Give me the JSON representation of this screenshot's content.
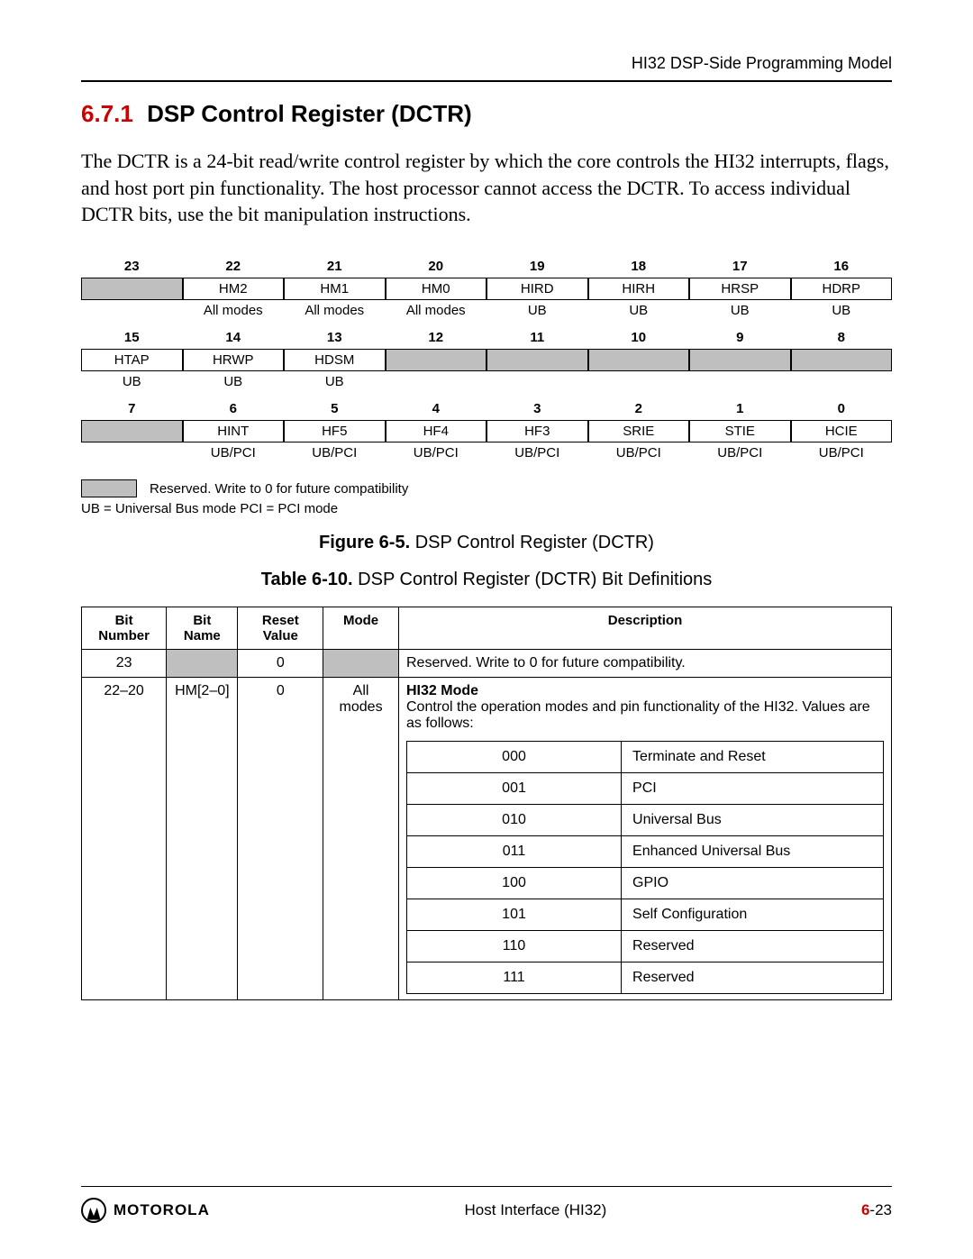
{
  "header": {
    "right_text": "HI32 DSP-Side Programming Model"
  },
  "section": {
    "number": "6.7.1",
    "title": "DSP Control Register (DCTR)",
    "paragraph": "The DCTR is a 24-bit read/write control register by which the core controls the HI32 interrupts, flags, and host port pin functionality. The host processor cannot access the DCTR. To access individual DCTR bits, use the bit manipulation instructions."
  },
  "register_figure": {
    "rows": [
      {
        "bits": [
          "23",
          "22",
          "21",
          "20",
          "19",
          "18",
          "17",
          "16"
        ],
        "names": [
          "",
          "HM2",
          "HM1",
          "HM0",
          "HIRD",
          "HIRH",
          "HRSP",
          "HDRP"
        ],
        "shaded": [
          true,
          false,
          false,
          false,
          false,
          false,
          false,
          false
        ],
        "modes": [
          "",
          "All modes",
          "All modes",
          "All modes",
          "UB",
          "UB",
          "UB",
          "UB"
        ]
      },
      {
        "bits": [
          "15",
          "14",
          "13",
          "12",
          "11",
          "10",
          "9",
          "8"
        ],
        "names": [
          "HTAP",
          "HRWP",
          "HDSM",
          "",
          "",
          "",
          "",
          ""
        ],
        "shaded": [
          false,
          false,
          false,
          true,
          true,
          true,
          true,
          true
        ],
        "modes": [
          "UB",
          "UB",
          "UB",
          "",
          "",
          "",
          "",
          ""
        ]
      },
      {
        "bits": [
          "7",
          "6",
          "5",
          "4",
          "3",
          "2",
          "1",
          "0"
        ],
        "names": [
          "",
          "HINT",
          "HF5",
          "HF4",
          "HF3",
          "SRIE",
          "STIE",
          "HCIE"
        ],
        "shaded": [
          true,
          false,
          false,
          false,
          false,
          false,
          false,
          false
        ],
        "modes": [
          "",
          "UB/PCI",
          "UB/PCI",
          "UB/PCI",
          "UB/PCI",
          "UB/PCI",
          "UB/PCI",
          "UB/PCI"
        ]
      }
    ],
    "legend_reserved": "Reserved. Write to 0 for future compatibility",
    "legend_ub_pci": "UB = Universal Bus mode    PCI = PCI mode",
    "caption_lead": "Figure 6-5.",
    "caption_text": " DSP Control Register (DCTR)"
  },
  "bit_table": {
    "caption_lead": "Table 6-10.",
    "caption_text": " DSP Control Register (DCTR) Bit Definitions",
    "headers": {
      "bit_number": "Bit Number",
      "bit_name": "Bit Name",
      "reset_value": "Reset Value",
      "mode": "Mode",
      "description": "Description"
    },
    "row_reserved": {
      "bit_number": "23",
      "reset_value": "0",
      "description": "Reserved. Write to 0 for future compatibility."
    },
    "row_hm": {
      "bit_number": "22–20",
      "bit_name": "HM[2–0]",
      "reset_value": "0",
      "mode": "All modes",
      "title": "HI32 Mode",
      "text": "Control the operation modes and pin functionality of the HI32. Values are as follows:",
      "modes": [
        {
          "code": "000",
          "label": "Terminate and Reset"
        },
        {
          "code": "001",
          "label": "PCI"
        },
        {
          "code": "010",
          "label": "Universal Bus"
        },
        {
          "code": "011",
          "label": "Enhanced Universal Bus"
        },
        {
          "code": "100",
          "label": "GPIO"
        },
        {
          "code": "101",
          "label": "Self Configuration"
        },
        {
          "code": "110",
          "label": "Reserved"
        },
        {
          "code": "111",
          "label": "Reserved"
        }
      ]
    }
  },
  "footer": {
    "brand": "MOTOROLA",
    "center": "Host Interface (HI32)",
    "chapter": "6",
    "page": "-23"
  }
}
